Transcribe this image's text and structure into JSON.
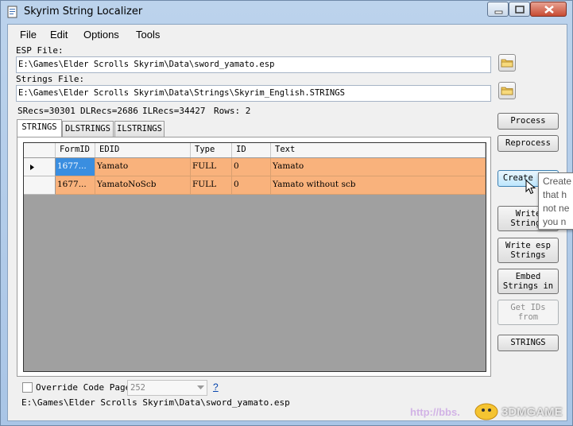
{
  "window": {
    "title": "Skyrim String Localizer"
  },
  "menu": [
    "File",
    "Edit",
    "Options",
    "Tools"
  ],
  "esp": {
    "label": "ESP File:",
    "value": "E:\\Games\\Elder Scrolls Skyrim\\Data\\sword_yamato.esp"
  },
  "strings_file": {
    "label": "Strings File:",
    "value": "E:\\Games\\Elder Scrolls Skyrim\\Data\\Strings\\Skyrim_English.STRINGS"
  },
  "stats": {
    "srecs": "SRecs=30301",
    "dlrecs": "DLRecs=2686",
    "ilrecs": "ILRecs=34427",
    "rows": "Rows: 2"
  },
  "tabs": [
    "STRINGS",
    "DLSTRINGS",
    "ILSTRINGS"
  ],
  "grid": {
    "columns": [
      "FormID",
      "EDID",
      "Type",
      "ID",
      "Text"
    ],
    "rows": [
      {
        "formid": "1677...",
        "edid": "Yamato",
        "type": "FULL",
        "id": "0",
        "text": "Yamato"
      },
      {
        "formid": "1677...",
        "edid": "YamatoNoScb",
        "type": "FULL",
        "id": "0",
        "text": "Yamato without scb"
      }
    ]
  },
  "buttons": {
    "process": "Process",
    "reprocess": "Reprocess",
    "create_ids": "Create IDs",
    "write_strings_1": "Write",
    "write_strings_2": "Strings",
    "write_esp_1": "Write esp",
    "write_esp_2": "Strings",
    "embed_1": "Embed",
    "embed_2": "Strings in",
    "getids_1": "Get IDs",
    "getids_2": "from",
    "strings": "STRINGS"
  },
  "tooltip": [
    "Create",
    "that h",
    "not ne",
    "you n"
  ],
  "override": {
    "label": "Override Code Page:",
    "value": "252",
    "help": "?"
  },
  "status_path": "E:\\Games\\Elder Scrolls Skyrim\\Data\\sword_yamato.esp",
  "watermark": {
    "url": "http://bbs.",
    "brand": "3DMGAME"
  }
}
